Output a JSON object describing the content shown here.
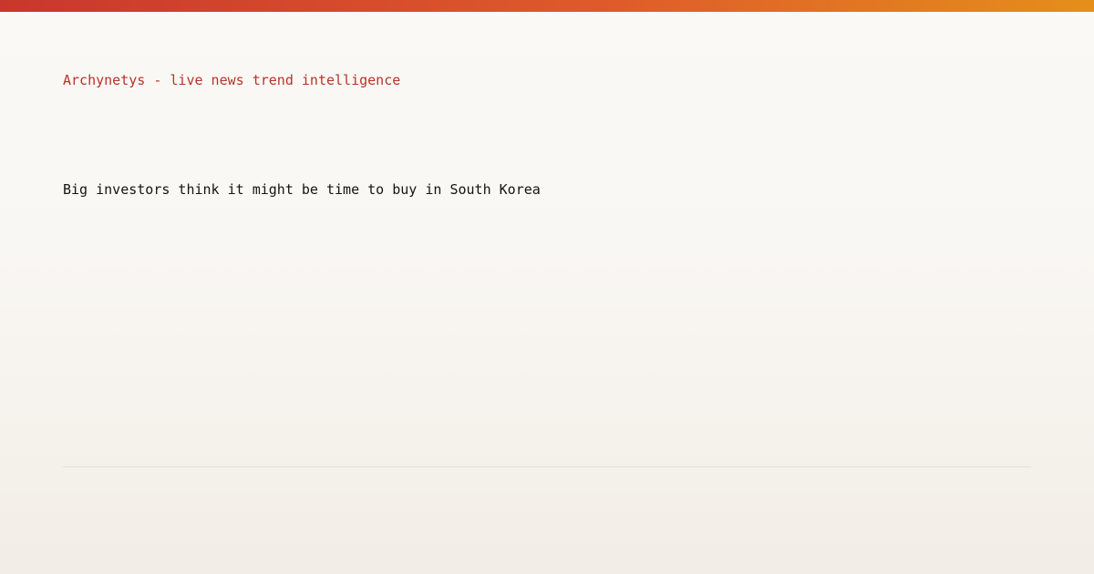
{
  "brand": {
    "text": "Archynetys - live news trend intelligence",
    "color": "#b8322a"
  },
  "headline": {
    "text": "Big investors think it might be time to buy in South Korea"
  },
  "colors": {
    "accent_start": "#c9372c",
    "accent_end": "#e58f1a",
    "background": "#faf9f5"
  }
}
